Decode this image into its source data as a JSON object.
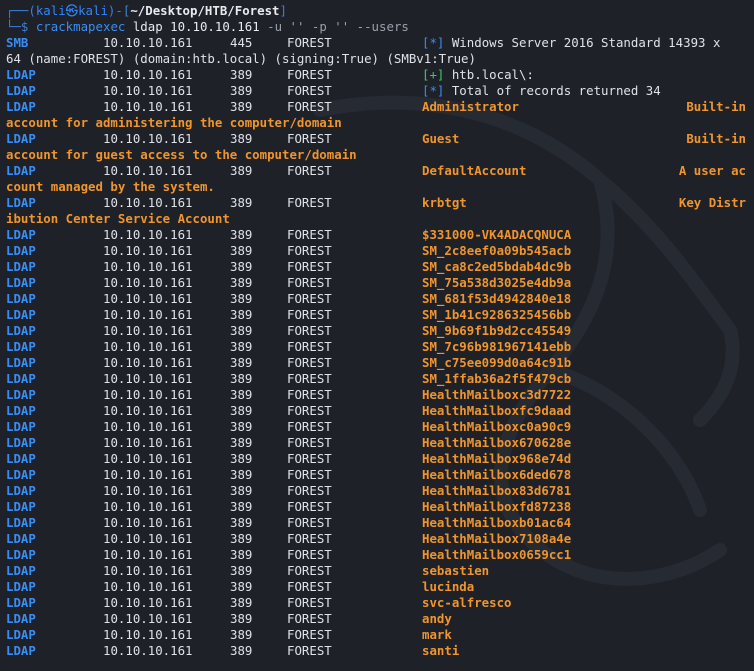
{
  "prompt": {
    "line1_open": "┌──(",
    "user": "kali㉿kali",
    "line1_mid": ")-[",
    "path": "~/Desktop/HTB/Forest",
    "line1_close": "]",
    "line2_prefix": "└─$ ",
    "command": "crackmapexec",
    "args": " ldap 10.10.10.161 ",
    "flags": "-u '' -p '' --users"
  },
  "smb": {
    "proto": "SMB",
    "ip": "10.10.10.161",
    "port": "445",
    "host": "FOREST",
    "tag": "[*]",
    "text": " Windows Server 2016 Standard 14393 x",
    "wrap": "64 (name:FOREST) (domain:htb.local) (signing:True) (SMBv1:True)"
  },
  "ldap_proto": "LDAP",
  "ldap_ip": "10.10.10.161",
  "ldap_port": "389",
  "ldap_host": "FOREST",
  "status_lines": [
    {
      "tag": "[+]",
      "text": " htb.local\\:"
    },
    {
      "tag": "[*]",
      "text": " Total of records returned 34"
    }
  ],
  "described_users": [
    {
      "name": "Administrator",
      "desc": "Built-in",
      "wrap": "account for administering the computer/domain"
    },
    {
      "name": "Guest",
      "desc": "Built-in",
      "wrap": "account for guest access to the computer/domain"
    },
    {
      "name": "DefaultAccount",
      "desc": "A user ac",
      "wrap": "count managed by the system."
    },
    {
      "name": "krbtgt",
      "desc": "Key Distr",
      "wrap": "ibution Center Service Account"
    }
  ],
  "users": [
    "$331000-VK4ADACQNUCA",
    "SM_2c8eef0a09b545acb",
    "SM_ca8c2ed5bdab4dc9b",
    "SM_75a538d3025e4db9a",
    "SM_681f53d4942840e18",
    "SM_1b41c9286325456bb",
    "SM_9b69f1b9d2cc45549",
    "SM_7c96b981967141ebb",
    "SM_c75ee099d0a64c91b",
    "SM_1ffab36a2f5f479cb",
    "HealthMailboxc3d7722",
    "HealthMailboxfc9daad",
    "HealthMailboxc0a90c9",
    "HealthMailbox670628e",
    "HealthMailbox968e74d",
    "HealthMailbox6ded678",
    "HealthMailbox83d6781",
    "HealthMailboxfd87238",
    "HealthMailboxb01ac64",
    "HealthMailbox7108a4e",
    "HealthMailbox0659cc1",
    "sebastien",
    "lucinda",
    "svc-alfresco",
    "andy",
    "mark",
    "santi"
  ],
  "colors": {
    "background": "#1e2128",
    "proto": "#3a8df5",
    "user": "#f0952d",
    "success": "#3ccc60"
  }
}
